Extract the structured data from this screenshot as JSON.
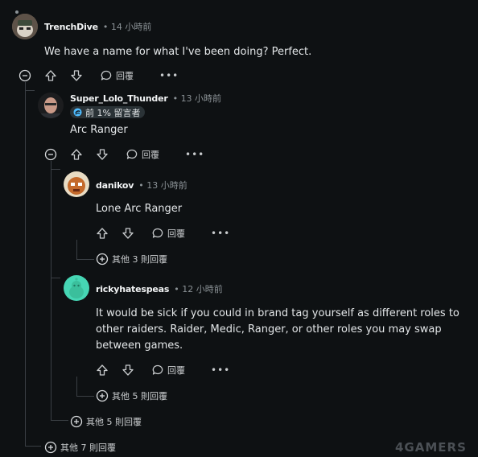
{
  "comments": [
    {
      "user": "TrenchDive",
      "time": "• 14 小時前",
      "text": "We have a name for what I've been doing? Perfect.",
      "reply": "回覆",
      "more_replies": "其他 7 則回覆"
    },
    {
      "user": "Super_Lolo_Thunder",
      "time": "• 13 小時前",
      "flair": "前 1% 留言者",
      "text": "Arc Ranger",
      "reply": "回覆",
      "more_replies": "其他 5 則回覆"
    },
    {
      "user": "danikov",
      "time": "• 13 小時前",
      "text": "Lone Arc Ranger",
      "reply": "回覆",
      "more_replies": "其他 3 則回覆"
    },
    {
      "user": "rickyhatespeas",
      "time": "• 12 小時前",
      "text_lines": [
        "It would be sick if you could in brand tag yourself as different roles to",
        "other raiders. Raider, Medic, Ranger, or other roles you may swap",
        "between games."
      ],
      "reply": "回覆",
      "more_replies": "其他 5 則回覆"
    }
  ],
  "more_label": "•••",
  "watermark": "4GAMERS",
  "colors": {
    "background": "#0e1113",
    "thread_line": "#3a3f44",
    "flair_bg": "#2a3236"
  }
}
